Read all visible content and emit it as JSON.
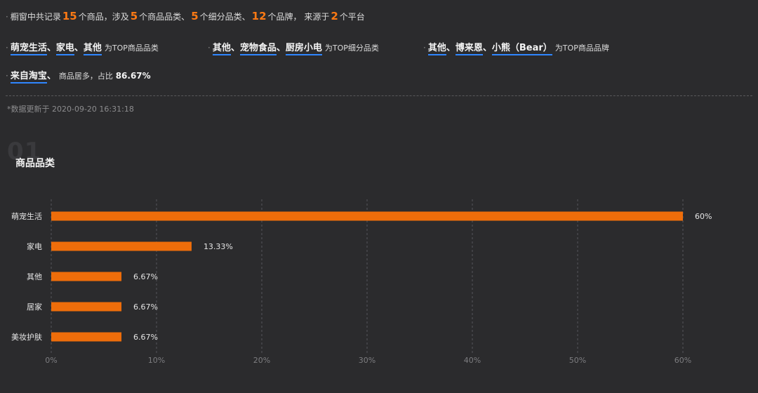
{
  "summary": {
    "line1": {
      "prefix": "橱窗中共记录",
      "goods_count": "15",
      "t1": "个商品，涉及",
      "category_count": "5",
      "t2": "个商品品类、",
      "subcategory_count": "5",
      "t3": "个细分品类、",
      "brand_count": "12",
      "t4": "个品牌， 来源于",
      "platform_count": "2",
      "t5": "个平台"
    },
    "top_categories": [
      "萌宠生活",
      "家电",
      "其他"
    ],
    "top_categories_label": "为TOP商品品类",
    "top_subcategories": [
      "其他",
      "宠物食品",
      "厨房小电"
    ],
    "top_subcategories_label": "为TOP细分品类",
    "top_brands": [
      "其他",
      "博来恩",
      "小熊（Bear）"
    ],
    "top_brands_label": "为TOP商品品牌",
    "source_platform": "来自淘宝",
    "source_text": "商品居多，占比",
    "source_share": "86.67%"
  },
  "separator": "、",
  "bullet": "·",
  "updated_at": "*数据更新于 2020-09-20 16:31:18",
  "section": {
    "number": "01",
    "title": "商品品类"
  },
  "colors": {
    "bar": "#ee6d0a",
    "highlight": "#ff7a14",
    "underline": "#2f86ff",
    "grid": "#55555a",
    "axis_text": "#7d7d80",
    "label_text": "#e6e6e6"
  },
  "chart_data": {
    "type": "bar",
    "orientation": "horizontal",
    "categories": [
      "萌宠生活",
      "家电",
      "其他",
      "居家",
      "美妆护肤"
    ],
    "values": [
      60,
      13.33,
      6.67,
      6.67,
      6.67
    ],
    "data_labels": [
      "60%",
      "13.33%",
      "6.67%",
      "6.67%",
      "6.67%"
    ],
    "xlim": [
      0,
      60
    ],
    "xticks": [
      0,
      10,
      20,
      30,
      40,
      50,
      60
    ],
    "xtick_labels": [
      "0%",
      "10%",
      "20%",
      "30%",
      "40%",
      "50%",
      "60%"
    ],
    "grid": "vertical dashed"
  }
}
